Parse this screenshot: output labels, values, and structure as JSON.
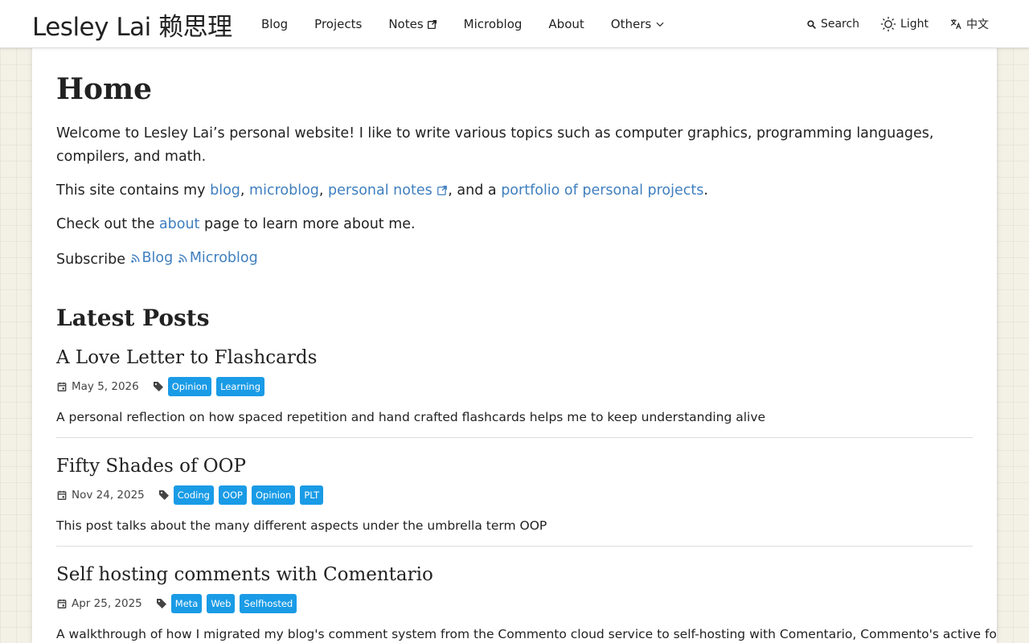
{
  "header": {
    "site_title": "Lesley Lai 赖思理",
    "nav": [
      {
        "label": "Blog",
        "external": false,
        "dropdown": false
      },
      {
        "label": "Projects",
        "external": false,
        "dropdown": false
      },
      {
        "label": "Notes",
        "external": true,
        "dropdown": false
      },
      {
        "label": "Microblog",
        "external": false,
        "dropdown": false
      },
      {
        "label": "About",
        "external": false,
        "dropdown": false
      },
      {
        "label": "Others",
        "external": false,
        "dropdown": true
      }
    ],
    "search_label": "Search",
    "theme_label": "Light",
    "lang_label": "中文"
  },
  "main": {
    "title": "Home",
    "intro": "Welcome to Lesley Lai’s personal website! I like to write various topics such as computer graphics, programming languages, compilers, and math.",
    "contains_prefix": "This site contains my ",
    "link_blog": "blog",
    "comma1": ", ",
    "link_microblog": "microblog",
    "comma2": ", ",
    "link_notes": "personal notes",
    "and_a": ", and a ",
    "link_portfolio": "portfolio of personal projects",
    "period": ".",
    "about_prefix": "Check out the ",
    "link_about": "about",
    "about_suffix": " page to learn more about me.",
    "subscribe_label": "Subscribe ",
    "subscribe_blog": "Blog",
    "subscribe_microblog": "Microblog",
    "latest_title": "Latest Posts"
  },
  "posts": [
    {
      "title": "A Love Letter to Flashcards",
      "date": "May 5, 2026",
      "tags": [
        "Opinion",
        "Learning"
      ],
      "description": "A personal reflection on how spaced repetition and hand crafted flashcards helps me to keep understanding alive"
    },
    {
      "title": "Fifty Shades of OOP",
      "date": "Nov 24, 2025",
      "tags": [
        "Coding",
        "OOP",
        "Opinion",
        "PLT"
      ],
      "description": "This post talks about the many different aspects under the umbrella term OOP"
    },
    {
      "title": "Self hosting comments with Comentario",
      "date": "Apr 25, 2025",
      "tags": [
        "Meta",
        "Web",
        "Selfhosted"
      ],
      "description": "A walkthrough of how I migrated my blog's comment system from the Commento cloud service to self-hosting with Comentario, Commento's active fork. I share"
    }
  ],
  "colors": {
    "link": "#3f7fbf",
    "tag_bg": "#1a9be6",
    "page_bg": "#f3f0e6"
  },
  "icons": [
    "external-link-icon",
    "chevron-down-icon",
    "search-icon",
    "sun-icon",
    "translate-icon",
    "rss-icon",
    "calendar-icon",
    "tag-icon"
  ]
}
